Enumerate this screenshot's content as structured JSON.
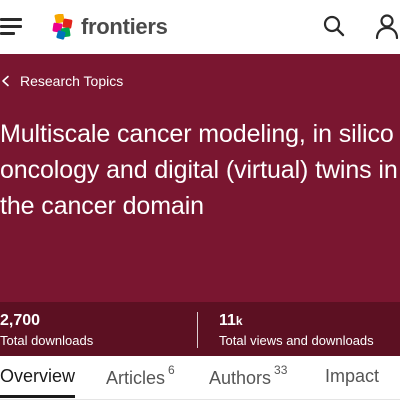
{
  "header": {
    "menu_icon": "hamburger-menu-icon",
    "logo_text": "frontiers",
    "search_icon": "search-icon",
    "account_icon": "user-icon",
    "logo_colors": [
      "#e2231a",
      "#f7a800",
      "#00a651",
      "#0072bc",
      "#ec008c"
    ]
  },
  "hero": {
    "background_color": "#7a1630",
    "breadcrumb_label": "Research Topics",
    "title": "Multiscale cancer modeling, in silico oncology and digital (virtual) twins in the cancer domain"
  },
  "stats": {
    "downloads_value": "2,700",
    "downloads_label": "Total downloads",
    "views_value": "11",
    "views_suffix": "k",
    "views_label": "Total views and downloads"
  },
  "tabs": [
    {
      "label": "Overview",
      "count": ""
    },
    {
      "label": "Articles",
      "count": "6"
    },
    {
      "label": "Authors",
      "count": "33"
    },
    {
      "label": "Impact",
      "count": ""
    }
  ]
}
